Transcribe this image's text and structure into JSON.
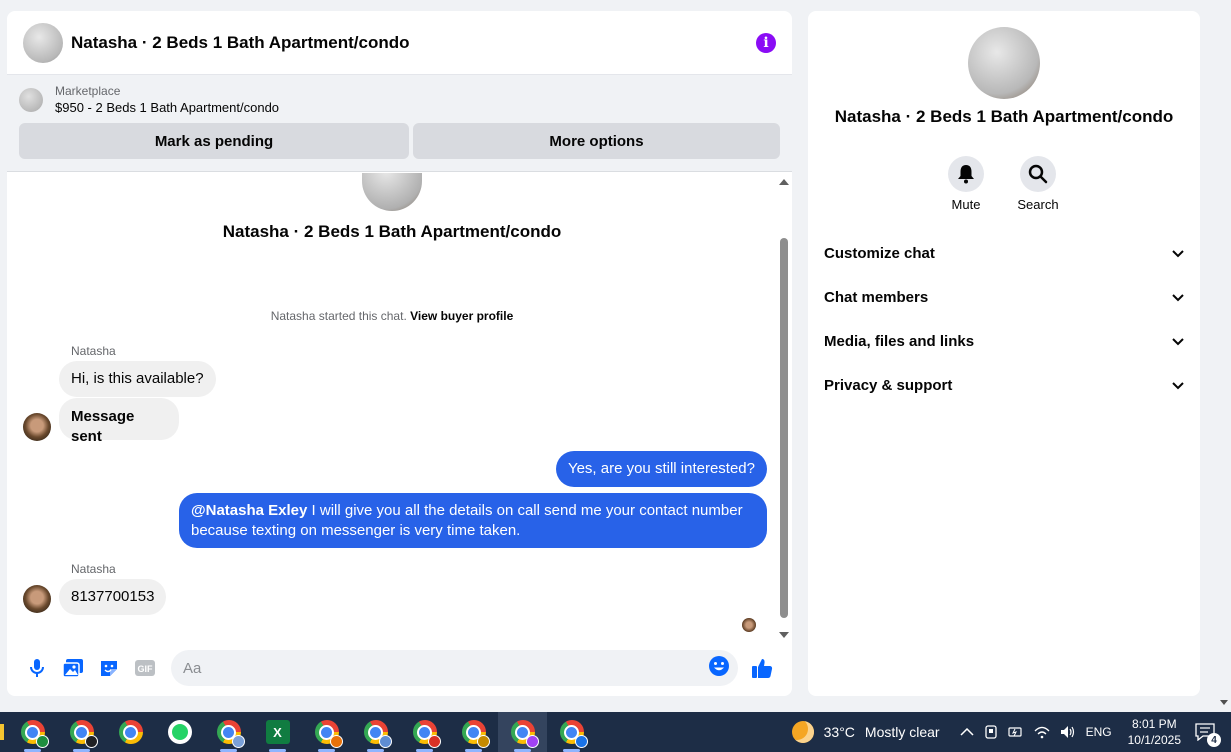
{
  "header": {
    "title": "Natasha · 2 Beds 1 Bath Apartment/condo"
  },
  "marketplace": {
    "label": "Marketplace",
    "listing": "$950 - 2 Beds 1 Bath Apartment/condo",
    "pending_button": "Mark as pending",
    "options_button": "More options"
  },
  "conversation": {
    "name": "Natasha · 2 Beds 1 Bath Apartment/condo",
    "started_text": "Natasha started this chat.",
    "buyer_link": "View buyer profile",
    "messages": [
      {
        "sender": "Natasha",
        "text": "Hi, is this available?"
      },
      {
        "text": "Message sent"
      },
      {
        "text": "Yes, are you still interested?"
      },
      {
        "mention": "@Natasha Exley",
        "text": " I will give you all the details on call send me your contact number because texting on messenger is very time taken."
      },
      {
        "sender": "Natasha",
        "text": "8137700153"
      }
    ]
  },
  "composer": {
    "placeholder": "Aa"
  },
  "info": {
    "name": "Natasha · 2 Beds 1 Bath Apartment/condo",
    "mute_label": "Mute",
    "search_label": "Search",
    "sections": [
      "Customize chat",
      "Chat members",
      "Media, files and links",
      "Privacy & support"
    ]
  },
  "taskbar": {
    "weather_temp": "33°C",
    "weather_text": "Mostly clear",
    "language": "ENG",
    "time": "8:01 PM",
    "date": "10/1/2025",
    "notifications": "4"
  },
  "colors": {
    "accent": "#2862e8",
    "info": "#8a0cf5",
    "taskbar": "#1d2d46"
  }
}
